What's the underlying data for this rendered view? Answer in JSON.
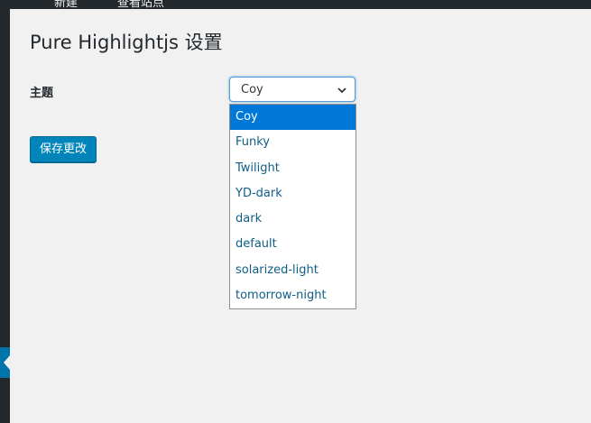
{
  "header": {
    "title": "Pure Highlightjs 设置"
  },
  "admin_bar": {
    "crumbs": [
      "新建",
      "查看站点"
    ]
  },
  "settings": {
    "theme_label": "主题",
    "theme_selected": "Coy",
    "theme_options": [
      "Coy",
      "Funky",
      "Twilight",
      "YD-dark",
      "dark",
      "default",
      "solarized-light",
      "tomorrow-night"
    ]
  },
  "actions": {
    "save_label": "保存更改"
  },
  "colors": {
    "accent": "#0085ba",
    "selected_option": "#0078d7",
    "admin_bar": "#23282d"
  },
  "icons": {
    "select": "chevron-down-icon"
  }
}
